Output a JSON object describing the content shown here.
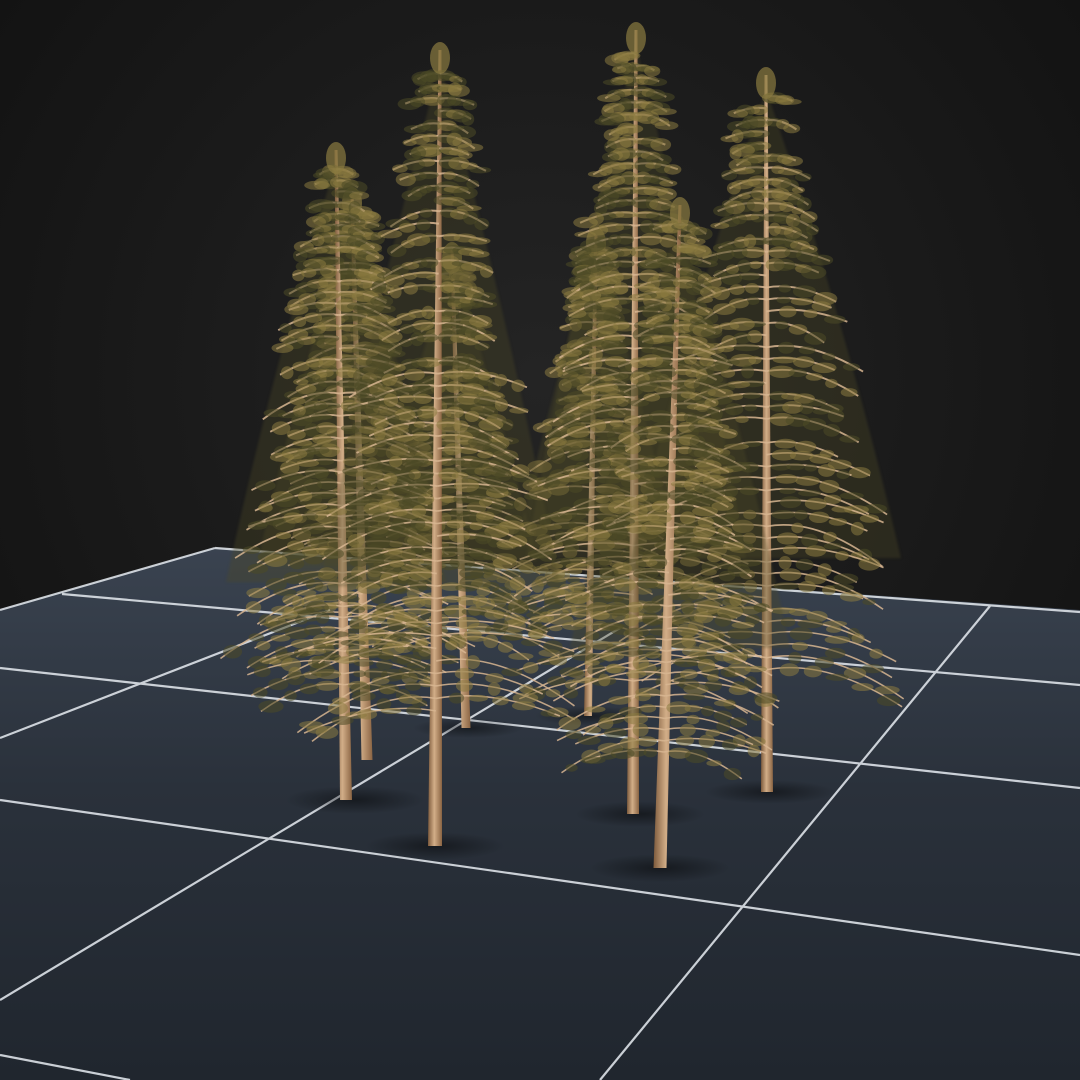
{
  "scene": {
    "background_color": "#151515",
    "floor_color": "#2b323d",
    "floor_grid_color": "#dde2e8",
    "bark_color": "#a37a55",
    "bark_highlight_color": "#d8b692",
    "needle_color": "#8a7a40",
    "needle_dark_color": "#4d4a26",
    "tree_count": 9,
    "floor_grid": true
  }
}
